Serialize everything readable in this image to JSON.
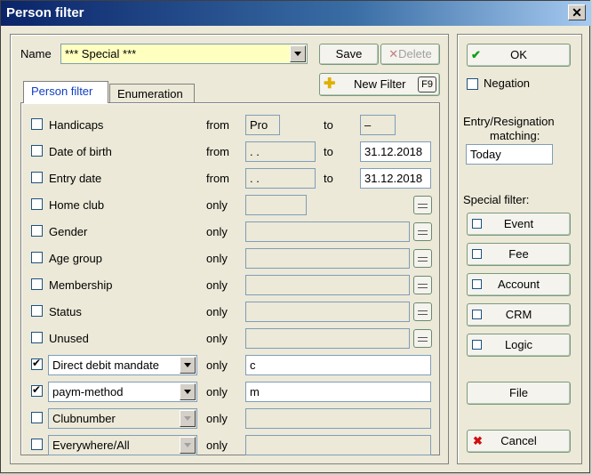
{
  "window": {
    "title": "Person filter"
  },
  "name": {
    "label": "Name",
    "value": "*** Special ***"
  },
  "buttons": {
    "save": "Save",
    "delete": "Delete",
    "new_filter": "New Filter",
    "new_filter_key": "F9",
    "ok": "OK",
    "file": "File",
    "cancel": "Cancel"
  },
  "tabs": [
    "Person filter",
    "Enumeration"
  ],
  "rows": [
    {
      "label": "Handicaps",
      "checked": false,
      "mode": "from",
      "from": "Pro",
      "to_label": "to",
      "to": "–"
    },
    {
      "label": "Date of birth",
      "checked": false,
      "mode": "from",
      "from": " .  .",
      "to_label": "to",
      "to": "31.12.2018"
    },
    {
      "label": "Entry date",
      "checked": false,
      "mode": "from",
      "from": " .  .",
      "to_label": "to",
      "to": "31.12.2018"
    },
    {
      "label": "Home club",
      "checked": false,
      "mode": "only",
      "value": ""
    },
    {
      "label": "Gender",
      "checked": false,
      "mode": "only",
      "value": ""
    },
    {
      "label": "Age group",
      "checked": false,
      "mode": "only",
      "value": ""
    },
    {
      "label": "Membership",
      "checked": false,
      "mode": "only",
      "value": ""
    },
    {
      "label": "Status",
      "checked": false,
      "mode": "only",
      "value": ""
    },
    {
      "label": "Unused",
      "checked": false,
      "mode": "only",
      "value": ""
    },
    {
      "label": "Direct debit mandate",
      "checked": true,
      "mode": "only",
      "value": "c"
    },
    {
      "label": "paym-method",
      "checked": true,
      "mode": "only",
      "value": "m"
    },
    {
      "label": "Clubnumber",
      "checked": false,
      "mode": "only",
      "value": ""
    },
    {
      "label": "Everywhere/All",
      "checked": false,
      "mode": "only",
      "value": ""
    }
  ],
  "right": {
    "negation": "Negation",
    "matching_label_1": "Entry/Resignation",
    "matching_label_2": "matching:",
    "matching_value": "Today",
    "special_label": "Special filter:",
    "special": [
      "Event",
      "Fee",
      "Account",
      "CRM",
      "Logic"
    ]
  }
}
